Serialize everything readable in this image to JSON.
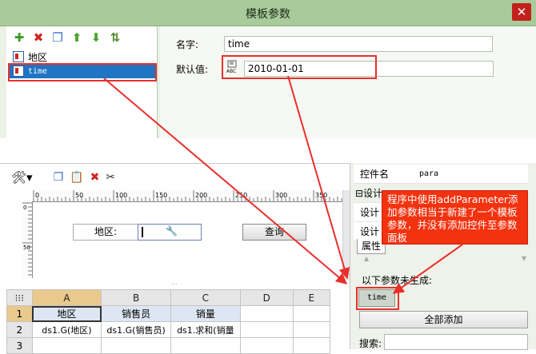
{
  "dialog": {
    "title": "模板参数",
    "close_label": "✕",
    "toolbar": [
      {
        "icon": "add-icon",
        "glyph": "✚",
        "color": "#3a9a28"
      },
      {
        "icon": "delete-icon",
        "glyph": "✖",
        "color": "#d0231f"
      },
      {
        "icon": "copy-icon",
        "glyph": "❐",
        "color": "#3a6fc6"
      },
      {
        "icon": "move-up-icon",
        "glyph": "⬆",
        "color": "#49a32f"
      },
      {
        "icon": "move-down-icon",
        "glyph": "⬇",
        "color": "#49a32f"
      },
      {
        "icon": "sort-icon",
        "glyph": "⇅",
        "color": "#4d8a2a"
      }
    ],
    "params": [
      {
        "label": "地区",
        "selected": false
      },
      {
        "label": "time",
        "selected": true
      }
    ],
    "name_label": "名字:",
    "name_value": "time",
    "default_label": "默认值:",
    "default_value": "2010-01-01",
    "default_type_icon": "ABC"
  },
  "designer": {
    "toolbar": [
      "tools-icon",
      "copy-icon",
      "paste-icon",
      "delete-icon",
      "cut-icon"
    ],
    "ruler_labels": [
      "0",
      "50",
      "100",
      "150",
      "200",
      "250",
      "300",
      "350"
    ],
    "ruler_v_labels": [
      "0",
      "50"
    ],
    "form": {
      "region_label": "地区:",
      "query_button": "查询"
    },
    "grid": {
      "columns": [
        "A",
        "B",
        "C",
        "D",
        "E"
      ],
      "rows": [
        {
          "num": "1",
          "cells": [
            "地区",
            "销售员",
            "销量",
            "",
            ""
          ]
        },
        {
          "num": "2",
          "cells": [
            "ds1.G(地区)",
            "ds1.G(销售员)",
            "ds1.求和(销量",
            "",
            ""
          ]
        },
        {
          "num": "3",
          "cells": [
            "",
            "",
            "",
            "",
            ""
          ]
        }
      ]
    }
  },
  "properties": {
    "rows": [
      {
        "key": "控件名",
        "value": "para"
      },
      {
        "key": "⊟设计",
        "value": ""
      },
      {
        "key": "设计",
        "value": ""
      },
      {
        "key": "设计",
        "value": ""
      }
    ],
    "tab_label": "属性",
    "callout": "程序中使用addParameter添加参数相当于新建了一个模板参数，并没有添加控件至参数面板",
    "unused_label": "以下参数未生成:",
    "unused_param": "time",
    "add_all_button": "全部添加",
    "search_label": "搜索:",
    "search_value": ""
  }
}
